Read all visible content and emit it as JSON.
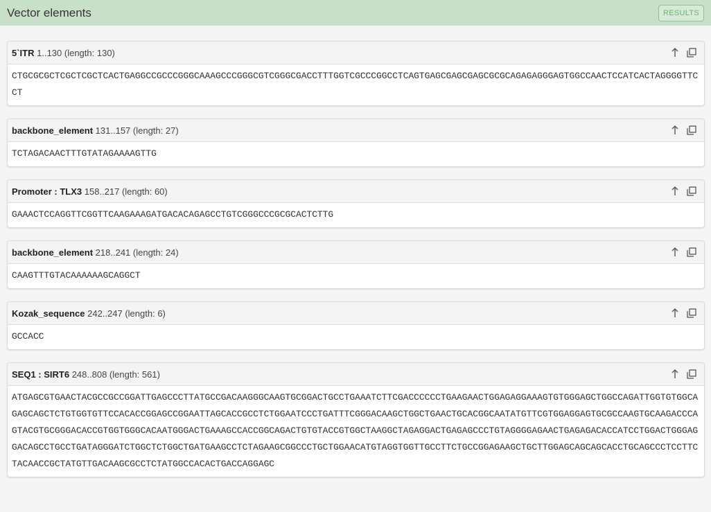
{
  "header": {
    "title": "Vector elements",
    "results_label": "RESULTS"
  },
  "elements": [
    {
      "name": "5`ITR",
      "range": "1..130 (length: 130)",
      "sequence": "CTGCGCGCTCGCTCGCTCACTGAGGCCGCCCGGGCAAAGCCCGGGCGTCGGGCGACCTTTGGTCGCCCGGCCTCAGTGAGCGAGCGAGCGCGCAGAGAGGGAGTGGCCAACTCCATCACTAGGGGTTCCT"
    },
    {
      "name": "backbone_element",
      "range": "131..157 (length: 27)",
      "sequence": "TCTAGACAACTTTGTATAGAAAAGTTG"
    },
    {
      "name": "Promoter : TLX3",
      "range": "158..217 (length: 60)",
      "sequence": "GAAACTCCAGGTTCGGTTCAAGAAAGATGACACAGAGCCTGTCGGGCCCGCGCACTCTTG"
    },
    {
      "name": "backbone_element",
      "range": "218..241 (length: 24)",
      "sequence": "CAAGTTTGTACAAAAAAGCAGGCT"
    },
    {
      "name": "Kozak_sequence",
      "range": "242..247 (length: 6)",
      "sequence": "GCCACC"
    },
    {
      "name": "SEQ1 : SIRT6",
      "range": "248..808 (length: 561)",
      "sequence": "ATGAGCGTGAACTACGCCGCCGGATTGAGCCCTTATGCCGACAAGGGCAAGTGCGGACTGCCTGAAATCTTCGACCCCCCTGAAGAACTGGAGAGGAAAGTGTGGGAGCTGGCCAGATTGGTGTGGCAGAGCAGCTCTGTGGTGTTCCACACCGGAGCCGGAATTAGCACCGCCTCTGGAATCCCTGATTTCGGGACAAGCTGGCTGAACTGCACGGCAATATGTTCGTGGAGGAGTGCGCCAAGTGCAAGACCCAGTACGTGCGGGACACCGTGGTGGGCACAATGGGACTGAAAGCCACCGGCAGACTGTGTACCGTGGCTAAGGCTAGAGGACTGAGAGCCCTGTAGGGGAGAACTGAGAGACACCATCCTGGACTGGGAGGACAGCCTGCCTGATAGGGATCTGGCTCTGGCTGATGAAGCCTCTAGAAGCGGCCCTGCTGGAACATGTAGGTGGTTGCCTTCTGCCGGAGAAGCTGCTTGGAGCAGCAGCACCTGCAGCCCTCCTTCTACAACCGCTATGTTGACAAGCGCCTCTATGGCCACACTGACCAGGAGC"
    }
  ],
  "icons": {
    "up": "arrow-up-icon",
    "copy": "copy-icon"
  }
}
